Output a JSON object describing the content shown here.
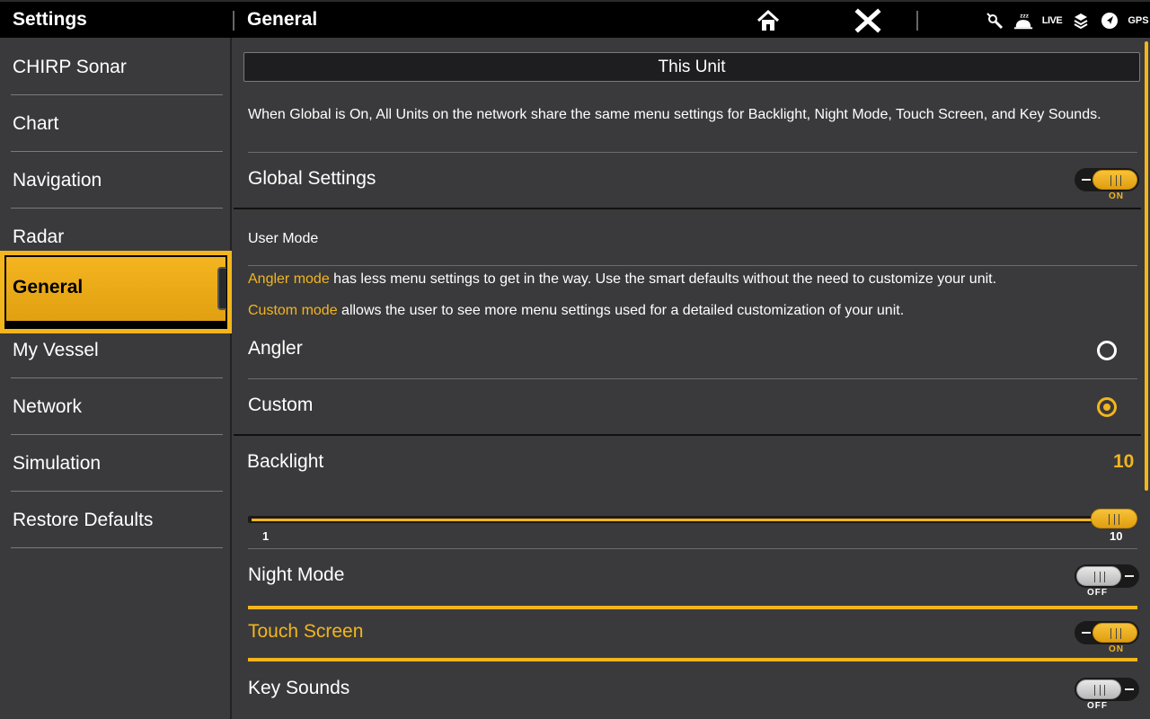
{
  "header": {
    "section_title": "Settings",
    "page_title": "General",
    "home_icon": "home-icon",
    "close_icon": "close-icon",
    "status": {
      "live_label": "LIVE",
      "gps_label": "GPS"
    }
  },
  "sidebar": {
    "items": [
      {
        "label": "CHIRP Sonar"
      },
      {
        "label": "Chart"
      },
      {
        "label": "Navigation"
      },
      {
        "label": "Radar"
      },
      {
        "label": "General",
        "selected": true
      },
      {
        "label": "My Vessel"
      },
      {
        "label": "Network"
      },
      {
        "label": "Simulation"
      },
      {
        "label": "Restore Defaults"
      }
    ]
  },
  "main": {
    "unit_selector": "This Unit",
    "global_description": "When Global is On, All Units on the network share the same menu settings for Backlight, Night Mode, Touch Screen, and Key Sounds.",
    "global_settings": {
      "label": "Global Settings",
      "state": "ON"
    },
    "user_mode": {
      "heading": "User Mode",
      "angler_desc_highlight": "Angler mode",
      "angler_desc_rest": " has less menu settings to get in the way. Use the smart defaults without the need to customize your unit.",
      "custom_desc_highlight": "Custom mode",
      "custom_desc_rest": " allows the user to see more menu settings used for a detailed customization of your unit.",
      "options": [
        {
          "label": "Angler",
          "selected": false
        },
        {
          "label": "Custom",
          "selected": true
        }
      ]
    },
    "backlight": {
      "label": "Backlight",
      "value": "10",
      "min_label": "1",
      "max_label": "10",
      "fraction": 1.0
    },
    "night_mode": {
      "label": "Night Mode",
      "state": "OFF"
    },
    "touch_screen": {
      "label": "Touch Screen",
      "state": "ON"
    },
    "key_sounds": {
      "label": "Key Sounds",
      "state": "OFF"
    }
  },
  "colors": {
    "accent": "#f3b51d",
    "background": "#3a3a3c",
    "topbar": "#000000"
  }
}
